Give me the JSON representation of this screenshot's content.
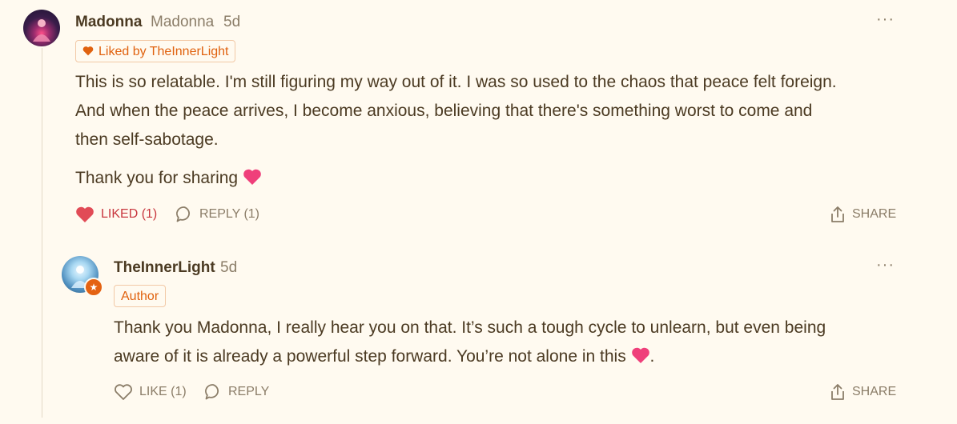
{
  "comment": {
    "author_name": "Madonna",
    "author_handle": "Madonna",
    "time": "5d",
    "liked_by_label": "Liked by TheInnerLight",
    "paragraphs": [
      "This is so relatable. I'm still figuring my way out of it. I was so used to the chaos that peace felt foreign.",
      "And when the peace arrives, I become anxious, believing that there's something worst to come and",
      "then self-sabotage."
    ],
    "thanks_text": "Thank you for sharing",
    "actions": {
      "like_label": "LIKED (1)",
      "reply_label": "REPLY (1)",
      "share_label": "SHARE"
    },
    "more_label": "···"
  },
  "reply": {
    "author_name": "TheInnerLight",
    "time": "5d",
    "author_tag": "Author",
    "lines": [
      "Thank you Madonna, I really hear you on that. It’s such a tough cycle to unlearn, but even being",
      "aware of it is already a powerful step forward. You’re not alone in this"
    ],
    "line_end": ".",
    "actions": {
      "like_label": "LIKE (1)",
      "reply_label": "REPLY",
      "share_label": "SHARE"
    },
    "more_label": "···"
  },
  "colors": {
    "background": "#fffaf0",
    "accent": "#e0620f",
    "liked": "#c8363e",
    "muted": "#8b7d68"
  }
}
